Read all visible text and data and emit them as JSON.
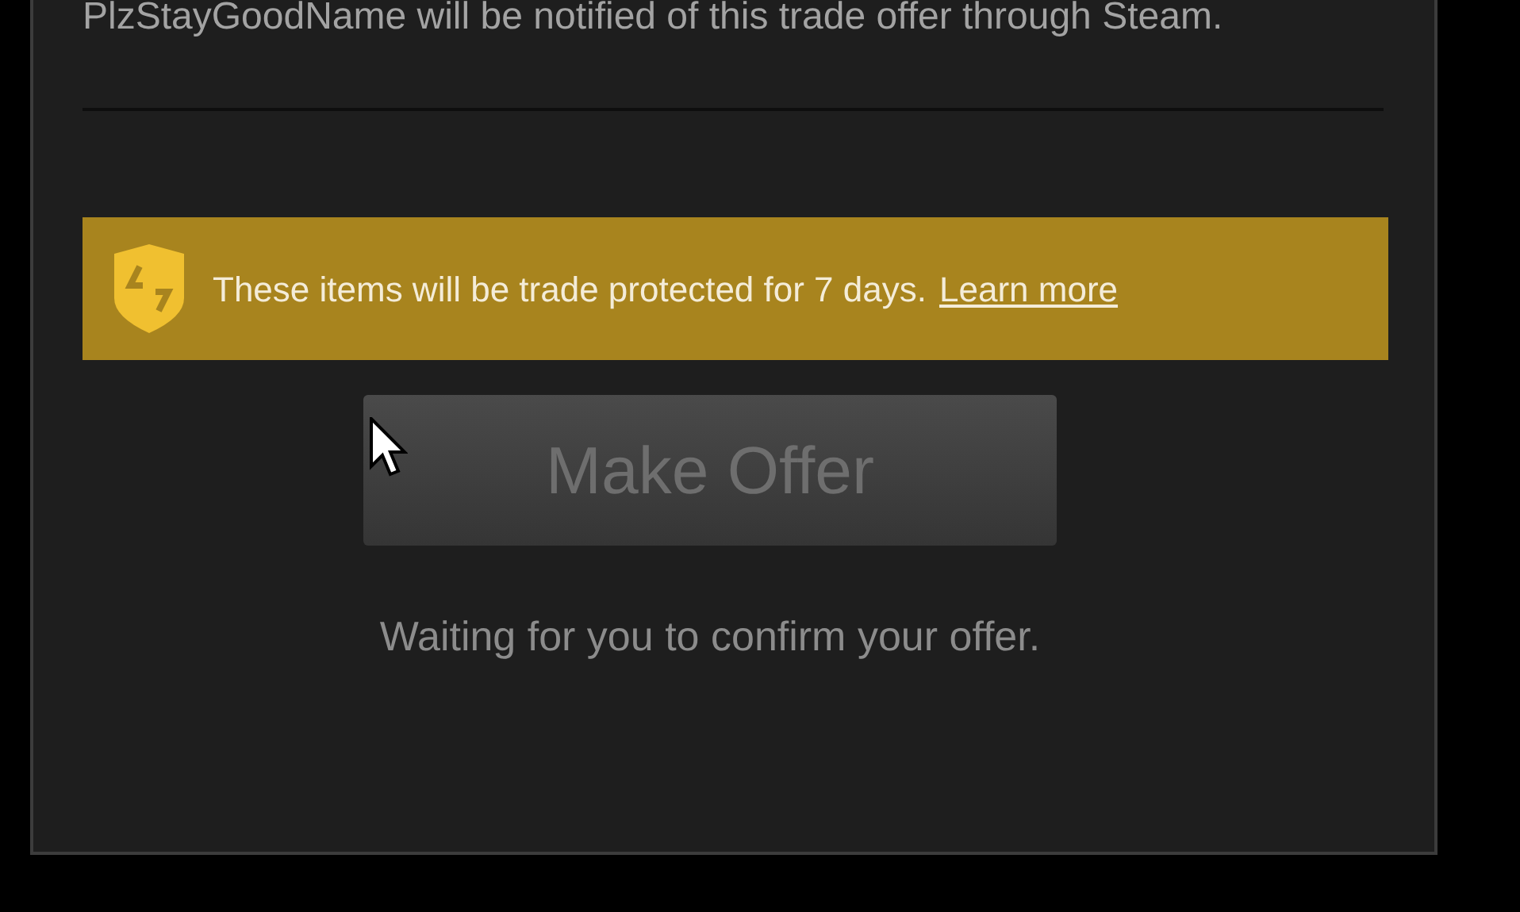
{
  "notice": "PlzStayGoodName will be notified of this trade offer through Steam.",
  "protection_banner": {
    "message": "These items will be trade protected for 7 days.",
    "link": "Learn more"
  },
  "make_offer_button": {
    "label": "Make Offer",
    "disabled": true
  },
  "status": "Waiting for you to confirm your offer."
}
